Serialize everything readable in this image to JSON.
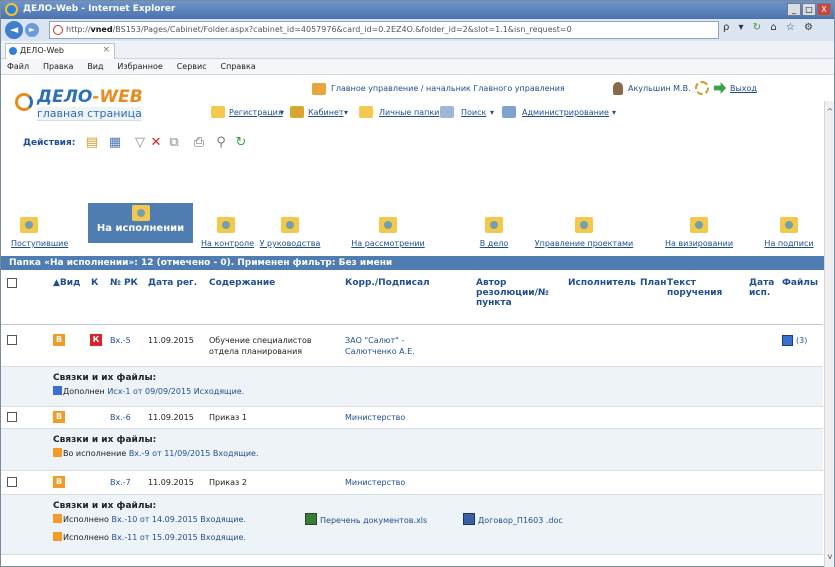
{
  "window": {
    "title": "ДЕЛО-Web - Internet Explorer",
    "minimize": "_",
    "maximize": "□",
    "close": "X"
  },
  "browser": {
    "url_prefix": "http://",
    "url_host": "vned",
    "url_rest": "/BS153/Pages/Cabinet/Folder.aspx?cabinet_id=4057976&card_id=0.2EZ4O.&folder_id=2&slot=1.1&isn_request=0",
    "search_glyph": "ρ",
    "tab_title": "ДЕЛО-Web",
    "tab_close": "×"
  },
  "menu": [
    "Файл",
    "Правка",
    "Вид",
    "Избранное",
    "Сервис",
    "Справка"
  ],
  "header": {
    "logo_part1": "ДЕЛО",
    "logo_part2": "-WEB",
    "logo_sub": "главная страница",
    "org_path": "Главное управление / начальник Главного управления",
    "user": "Акульшин М.В.",
    "logout": "Выход",
    "nav": {
      "registration": "Регистрация",
      "cabinet": "Кабинет",
      "personal_folders": "Личные папки",
      "search": "Поиск",
      "admin": "Администрирование"
    },
    "actions_label": "Действия:"
  },
  "folders": [
    {
      "label": "Поступившие"
    },
    {
      "label": "На исполнении"
    },
    {
      "label": "На контроле"
    },
    {
      "label": "У руководства"
    },
    {
      "label": "На рассмотрении"
    },
    {
      "label": "В дело"
    },
    {
      "label": "Управление проектами"
    },
    {
      "label": "На визировании"
    },
    {
      "label": "На подписи"
    }
  ],
  "folder_bar": "Папка «На исполнении»: 12 (отмечено - 0). Применен фильтр: Без имени",
  "table": {
    "headers": {
      "vid": "▲Вид",
      "k": "К",
      "rk": "№ РК",
      "date_reg": "Дата рег.",
      "content": "Содержание",
      "corr": "Корр./Подписал",
      "author_l1": "Автор",
      "author_l2": "резолюции/№",
      "author_l3": "пункта",
      "executor": "Исполнитель",
      "plan": "План",
      "text_l1": "Текст",
      "text_l2": "поручения",
      "date_isp_l1": "Дата",
      "date_isp_l2": "исп.",
      "files": "Файлы"
    },
    "badge_v": "В",
    "badge_k": "К",
    "links_title": "Связки и их файлы:",
    "rows": [
      {
        "rk": "Вх.-5",
        "date": "11.09.2015",
        "content_l1": "Обучение специалистов",
        "content_l2": "отдела планирования",
        "corr_l1": "ЗАО \"Салют\" -",
        "corr_l2": "Салютченко А.Е.",
        "files": "(3)",
        "link1_prefix": "Дополнен",
        "link1_text": "Исх-1 от 09/09/2015 Исходящие."
      },
      {
        "rk": "Вх.-6",
        "date": "11.09.2015",
        "content_l1": "Приказ 1",
        "corr_l1": "Министерство",
        "link1_prefix": "Во исполнение",
        "link1_text": "Вх.-9 от 11/09/2015 Входящие."
      },
      {
        "rk": "Вх.-7",
        "date": "11.09.2015",
        "content_l1": "Приказ 2",
        "corr_l1": "Министерство",
        "link1_prefix": "Исполнено",
        "link1_text": "Вх.-10 от 14.09.2015 Входящие.",
        "file1": "Перечень документов.xls",
        "file2": "Договор_П1603 .doc",
        "link2_prefix": "Исполнено",
        "link2_text": "Вх.-11 от 15.09.2015 Входящие."
      }
    ]
  },
  "colors": {
    "accent": "#4f7db2",
    "link": "#1f4f8f",
    "badge_v": "#f29b26",
    "badge_k": "#d9232a"
  }
}
